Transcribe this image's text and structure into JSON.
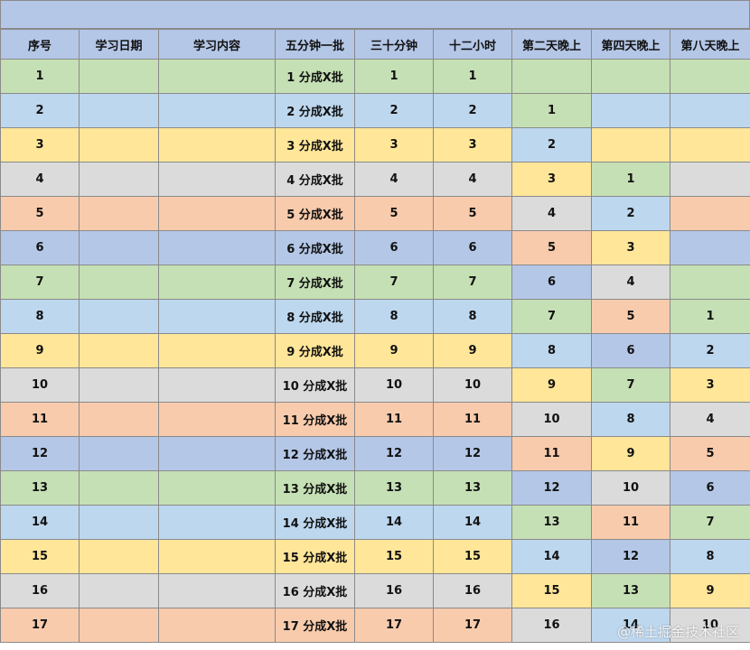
{
  "colors": [
    "#c5e0b4",
    "#bdd7ee",
    "#ffe699",
    "#dbdbdb",
    "#f8cbad",
    "#b4c7e7"
  ],
  "table": {
    "headers": [
      "序号",
      "学习日期",
      "学习内容",
      "五分钟一批",
      "三十分钟",
      "十二小时",
      "第二天晚上",
      "第四天晚上",
      "第八天晚上"
    ],
    "rows": [
      {
        "color": 0,
        "cells": [
          "1",
          "",
          "",
          "1 分成X批",
          "1",
          "1",
          "",
          "",
          ""
        ]
      },
      {
        "color": 1,
        "cells": [
          "2",
          "",
          "",
          "2 分成X批",
          "2",
          "2",
          "1",
          "",
          ""
        ]
      },
      {
        "color": 2,
        "cells": [
          "3",
          "",
          "",
          "3 分成X批",
          "3",
          "3",
          "2",
          "",
          ""
        ]
      },
      {
        "color": 3,
        "cells": [
          "4",
          "",
          "",
          "4 分成X批",
          "4",
          "4",
          "3",
          "1",
          ""
        ]
      },
      {
        "color": 4,
        "cells": [
          "5",
          "",
          "",
          "5 分成X批",
          "5",
          "5",
          "4",
          "2",
          ""
        ]
      },
      {
        "color": 5,
        "cells": [
          "6",
          "",
          "",
          "6 分成X批",
          "6",
          "6",
          "5",
          "3",
          ""
        ]
      },
      {
        "color": 0,
        "cells": [
          "7",
          "",
          "",
          "7 分成X批",
          "7",
          "7",
          "6",
          "4",
          ""
        ]
      },
      {
        "color": 1,
        "cells": [
          "8",
          "",
          "",
          "8 分成X批",
          "8",
          "8",
          "7",
          "5",
          "1"
        ]
      },
      {
        "color": 2,
        "cells": [
          "9",
          "",
          "",
          "9 分成X批",
          "9",
          "9",
          "8",
          "6",
          "2"
        ]
      },
      {
        "color": 3,
        "cells": [
          "10",
          "",
          "",
          "10 分成X批",
          "10",
          "10",
          "9",
          "7",
          "3"
        ]
      },
      {
        "color": 4,
        "cells": [
          "11",
          "",
          "",
          "11 分成X批",
          "11",
          "11",
          "10",
          "8",
          "4"
        ]
      },
      {
        "color": 5,
        "cells": [
          "12",
          "",
          "",
          "12 分成X批",
          "12",
          "12",
          "11",
          "9",
          "5"
        ]
      },
      {
        "color": 0,
        "cells": [
          "13",
          "",
          "",
          "13 分成X批",
          "13",
          "13",
          "12",
          "10",
          "6"
        ]
      },
      {
        "color": 1,
        "cells": [
          "14",
          "",
          "",
          "14 分成X批",
          "14",
          "14",
          "13",
          "11",
          "7"
        ]
      },
      {
        "color": 2,
        "cells": [
          "15",
          "",
          "",
          "15 分成X批",
          "15",
          "15",
          "14",
          "12",
          "8"
        ]
      },
      {
        "color": 3,
        "cells": [
          "16",
          "",
          "",
          "16 分成X批",
          "16",
          "16",
          "15",
          "13",
          "9"
        ]
      },
      {
        "color": 4,
        "cells": [
          "17",
          "",
          "",
          "17 分成X批",
          "17",
          "17",
          "16",
          "14",
          "10"
        ]
      }
    ]
  },
  "watermark": "@稀土掘金技术社区"
}
